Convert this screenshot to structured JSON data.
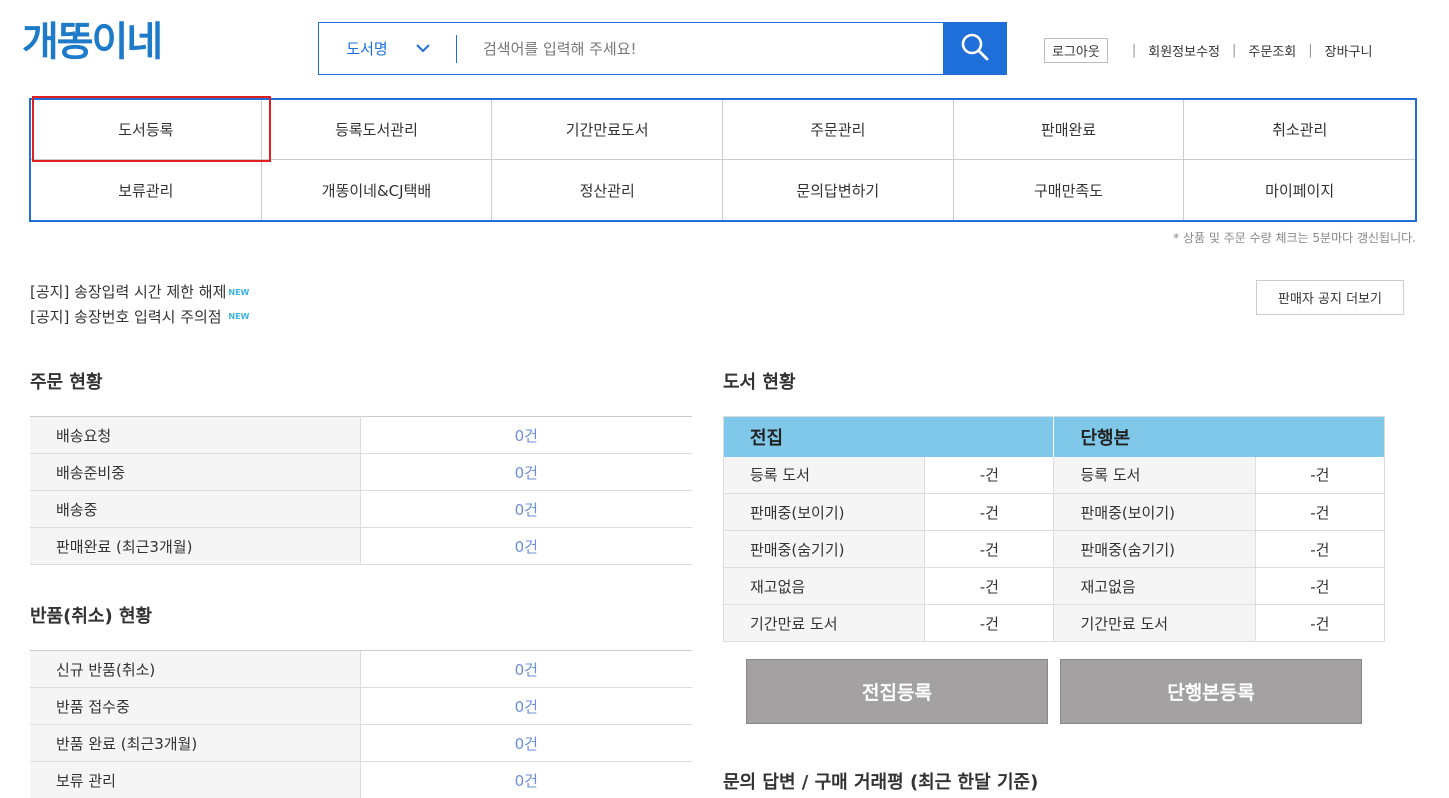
{
  "header": {
    "logo": "개똥이네",
    "search": {
      "category": "도서명",
      "placeholder": "검색어를 입력해 주세요!"
    },
    "links": {
      "logout": "로그아웃",
      "edit_profile": "회원정보수정",
      "orders": "주문조회",
      "cart": "장바구니"
    }
  },
  "menu": {
    "row1": [
      "도서등록",
      "등록도서관리",
      "기간만료도서",
      "주문관리",
      "판매완료",
      "취소관리"
    ],
    "row2": [
      "보류관리",
      "개똥이네&CJ택배",
      "정산관리",
      "문의답변하기",
      "구매만족도",
      "마이페이지"
    ]
  },
  "refresh_note": "* 상품 및 주문 수량 체크는 5분마다 갱신됩니다.",
  "notices": {
    "items": [
      "[공지] 송장입력 시간 제한 해제",
      "[공지] 송장번호 입력시 주의점"
    ],
    "badge": "NEW",
    "more_button": "판매자 공지 더보기"
  },
  "order_status": {
    "title": "주문 현황",
    "rows": [
      {
        "label": "배송요청",
        "value": "0건"
      },
      {
        "label": "배송준비중",
        "value": "0건"
      },
      {
        "label": "배송중",
        "value": "0건"
      },
      {
        "label": "판매완료 (최근3개월)",
        "value": "0건"
      }
    ]
  },
  "return_status": {
    "title": "반품(취소) 현황",
    "rows": [
      {
        "label": "신규 반품(취소)",
        "value": "0건"
      },
      {
        "label": "반품 접수중",
        "value": "0건"
      },
      {
        "label": "반품 완료 (최근3개월)",
        "value": "0건"
      },
      {
        "label": "보류 관리",
        "value": "0건"
      }
    ]
  },
  "book_status": {
    "title": "도서 현황",
    "col1_header": "전집",
    "col2_header": "단행본",
    "rows": [
      {
        "label": "등록 도서",
        "v1": "-건",
        "v2": "-건"
      },
      {
        "label": "판매중(보이기)",
        "v1": "-건",
        "v2": "-건"
      },
      {
        "label": "판매중(숨기기)",
        "v1": "-건",
        "v2": "-건"
      },
      {
        "label": "재고없음",
        "v1": "-건",
        "v2": "-건"
      },
      {
        "label": "기간만료 도서",
        "v1": "-건",
        "v2": "-건"
      }
    ],
    "btn_set": "전집등록",
    "btn_single": "단행본등록"
  },
  "inquiry_title": "문의 답변 / 구매 거래평 (최근 한달 기준)",
  "colors": {
    "primary": "#1e6fd9",
    "logo": "#1e7bc9",
    "table_header": "#7fc8ea",
    "value_text": "#6b8fd6",
    "highlight": "#e02020"
  },
  "icons": {
    "search": "search-icon",
    "dropdown": "chevron-down-icon"
  }
}
